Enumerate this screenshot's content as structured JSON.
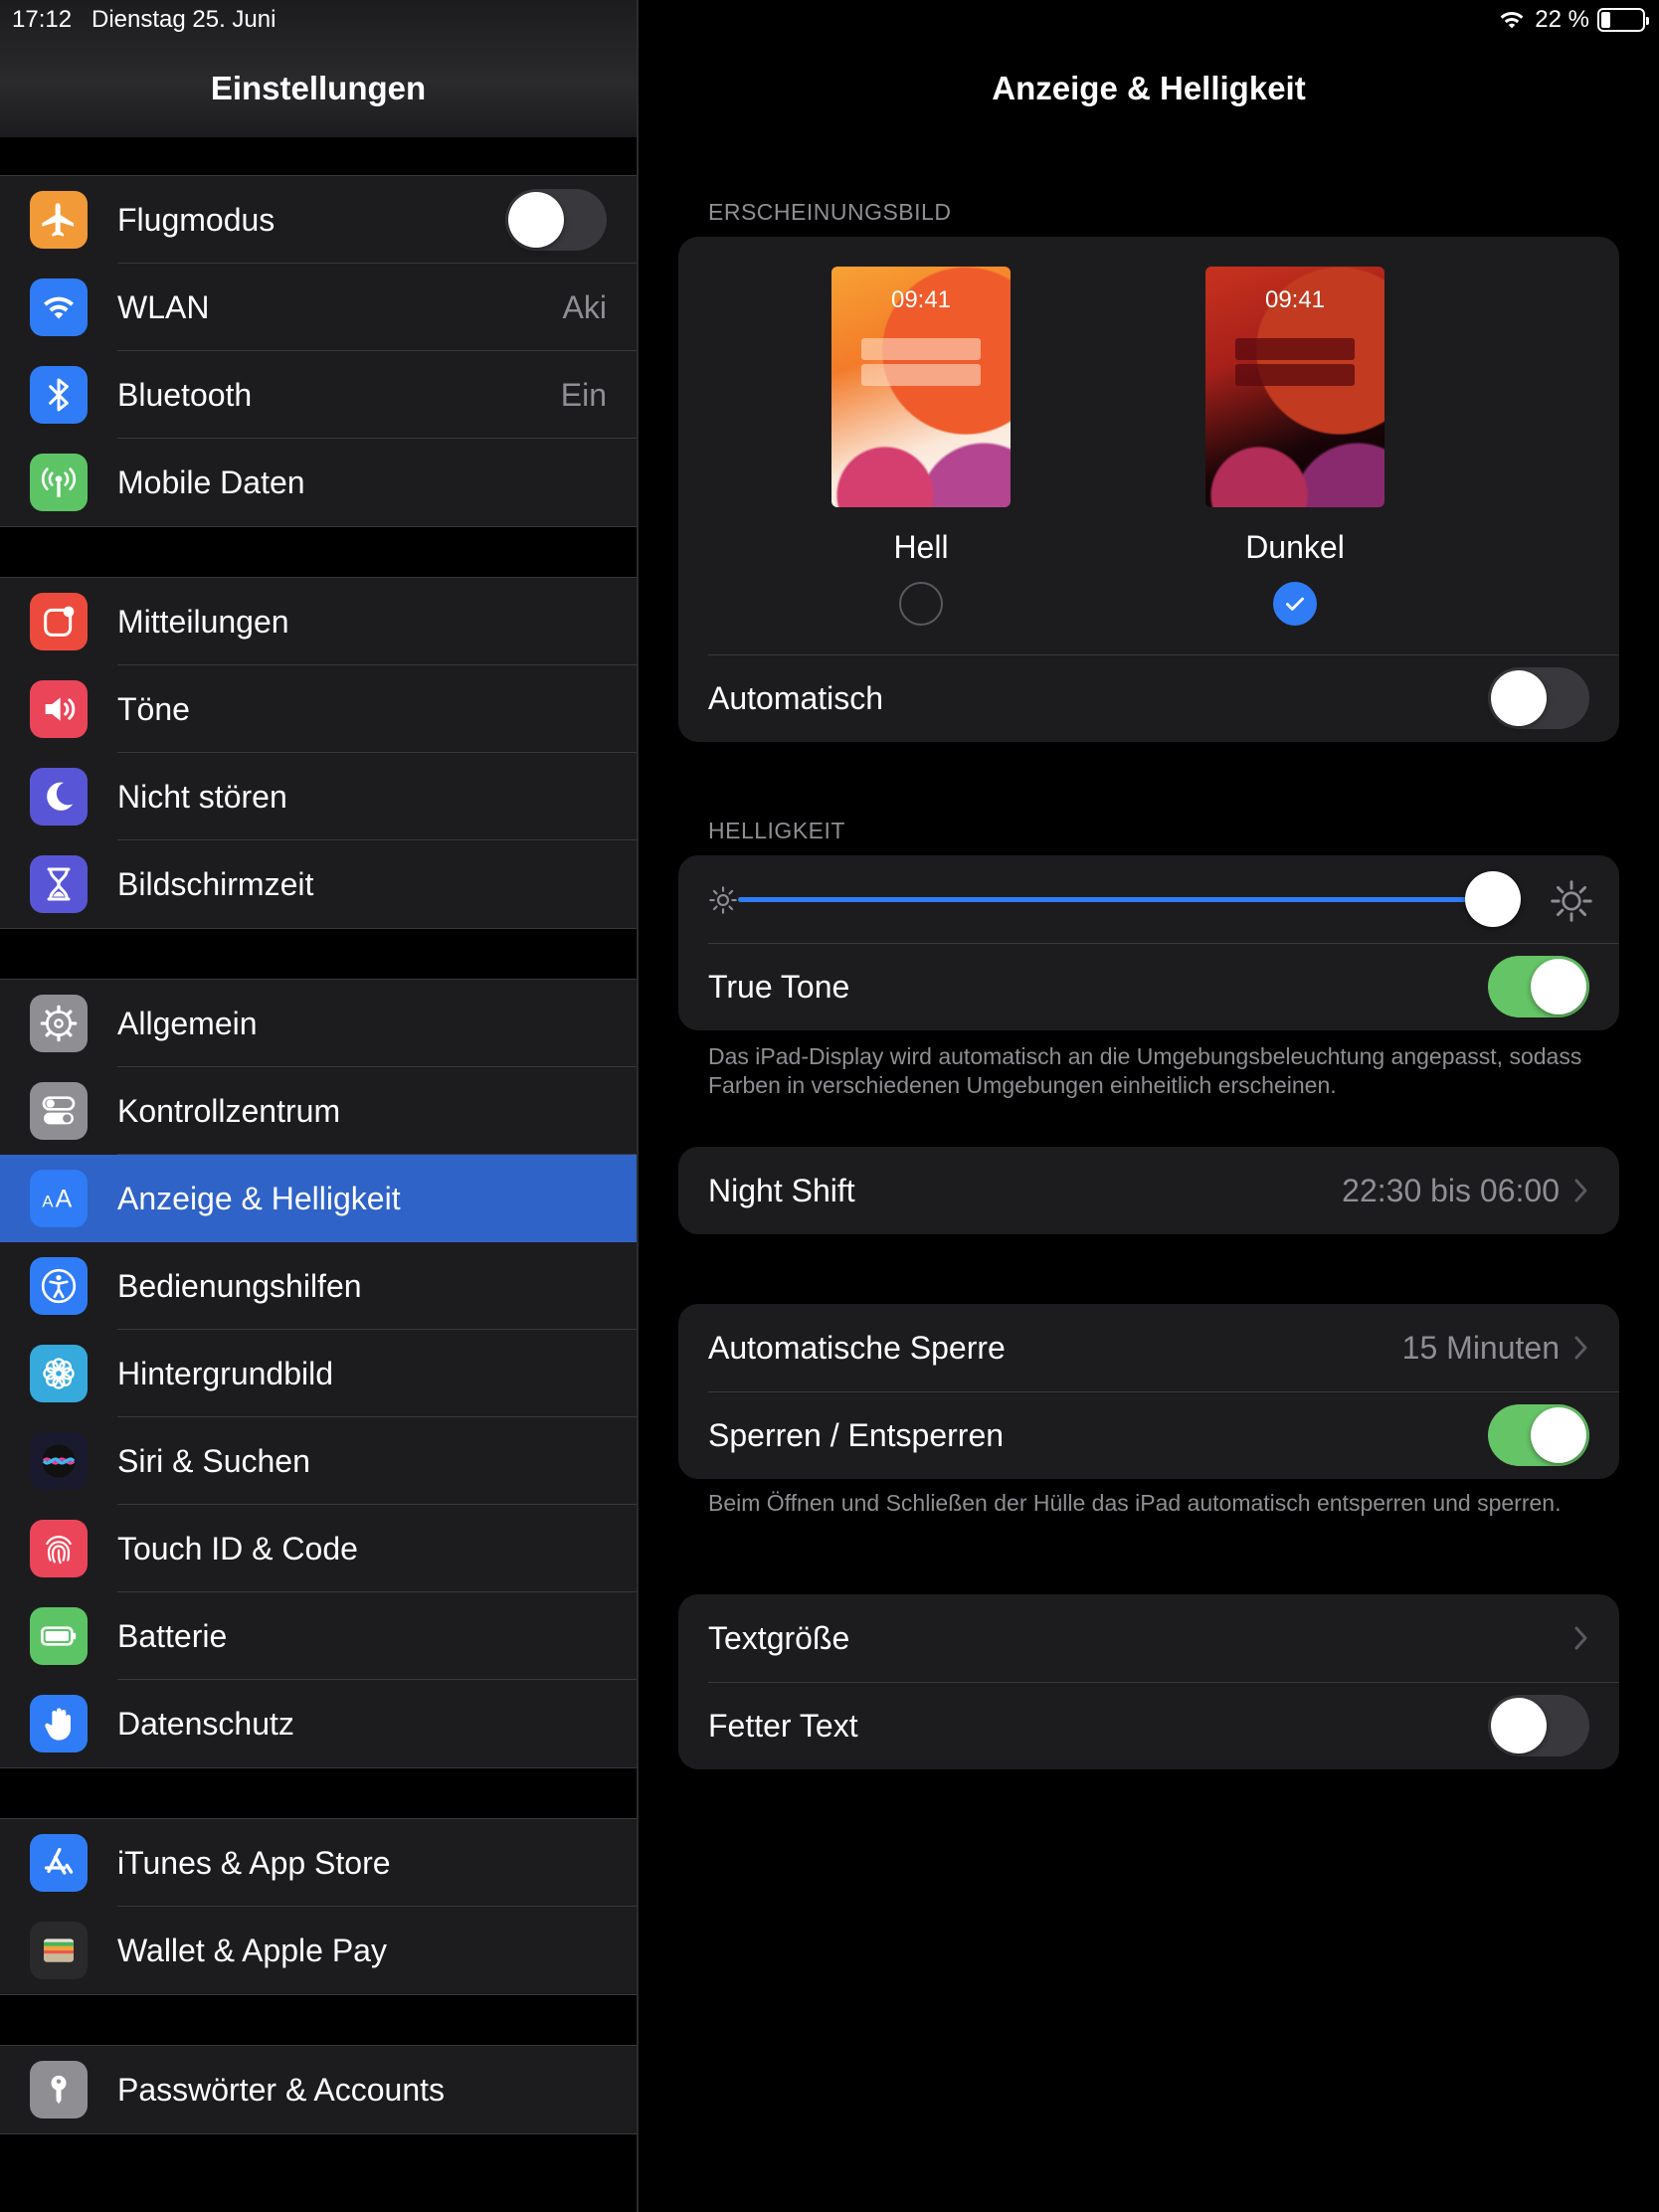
{
  "status": {
    "time": "17:12",
    "date": "Dienstag 25. Juni",
    "battery": "22 %",
    "battery_level": 0.22
  },
  "sidebar": {
    "title": "Einstellungen",
    "groups": [
      [
        {
          "label": "Flugmodus",
          "icon": "airplane-icon",
          "color": "#f29a38",
          "toggle": false
        },
        {
          "label": "WLAN",
          "icon": "wifi-icon",
          "color": "#2f7cf6",
          "value": "Aki"
        },
        {
          "label": "Bluetooth",
          "icon": "bluetooth-icon",
          "color": "#2f7cf6",
          "value": "Ein"
        },
        {
          "label": "Mobile Daten",
          "icon": "antenna-icon",
          "color": "#5dc466"
        }
      ],
      [
        {
          "label": "Mitteilungen",
          "icon": "notifications-icon",
          "color": "#ec4a3c"
        },
        {
          "label": "Töne",
          "icon": "speaker-icon",
          "color": "#eb4559"
        },
        {
          "label": "Nicht stören",
          "icon": "moon-icon",
          "color": "#5856d6"
        },
        {
          "label": "Bildschirmzeit",
          "icon": "hourglass-icon",
          "color": "#5856d6"
        }
      ],
      [
        {
          "label": "Allgemein",
          "icon": "gear-icon",
          "color": "#8e8e93"
        },
        {
          "label": "Kontrollzentrum",
          "icon": "switches-icon",
          "color": "#8e8e93"
        },
        {
          "label": "Anzeige & Helligkeit",
          "icon": "text-size-icon",
          "color": "#2f7cf6",
          "selected": true
        },
        {
          "label": "Bedienungshilfen",
          "icon": "accessibility-icon",
          "color": "#2f7cf6"
        },
        {
          "label": "Hintergrundbild",
          "icon": "flower-icon",
          "color": "#36aadc"
        },
        {
          "label": "Siri & Suchen",
          "icon": "siri-icon",
          "color": "#1a1a2e"
        },
        {
          "label": "Touch ID & Code",
          "icon": "fingerprint-icon",
          "color": "#eb4559"
        },
        {
          "label": "Batterie",
          "icon": "battery-icon",
          "color": "#5dc466"
        },
        {
          "label": "Datenschutz",
          "icon": "hand-icon",
          "color": "#2f7cf6"
        }
      ],
      [
        {
          "label": "iTunes & App Store",
          "icon": "app-store-icon",
          "color": "#2f7cf6"
        },
        {
          "label": "Wallet & Apple Pay",
          "icon": "wallet-icon",
          "color": "#2a2a2c"
        }
      ],
      [
        {
          "label": "Passwörter & Accounts",
          "icon": "key-icon",
          "color": "#8e8e93"
        }
      ]
    ]
  },
  "detail": {
    "title": "Anzeige & Helligkeit",
    "appearance": {
      "header": "ERSCHEINUNGSBILD",
      "light": {
        "label": "Hell",
        "time": "09:41",
        "checked": false
      },
      "dark": {
        "label": "Dunkel",
        "time": "09:41",
        "checked": true
      },
      "automatic": {
        "label": "Automatisch",
        "on": false
      }
    },
    "brightness": {
      "header": "HELLIGKEIT",
      "level": 0.97,
      "true_tone": {
        "label": "True Tone",
        "on": true
      },
      "footnote": "Das iPad-Display wird automatisch an die Umgebungsbeleuchtung angepasst, sodass Farben in verschiedenen Umgebungen einheitlich erscheinen."
    },
    "night_shift": {
      "label": "Night Shift",
      "value": "22:30 bis 06:00"
    },
    "lock": {
      "auto_lock": {
        "label": "Automatische Sperre",
        "value": "15 Minuten"
      },
      "lock_unlock": {
        "label": "Sperren / Entsperren",
        "on": true
      },
      "footnote": "Beim Öffnen und Schließen der Hülle das iPad automatisch entsperren und sperren."
    },
    "text": {
      "text_size": {
        "label": "Textgröße"
      },
      "bold_text": {
        "label": "Fetter Text",
        "on": false
      }
    }
  }
}
